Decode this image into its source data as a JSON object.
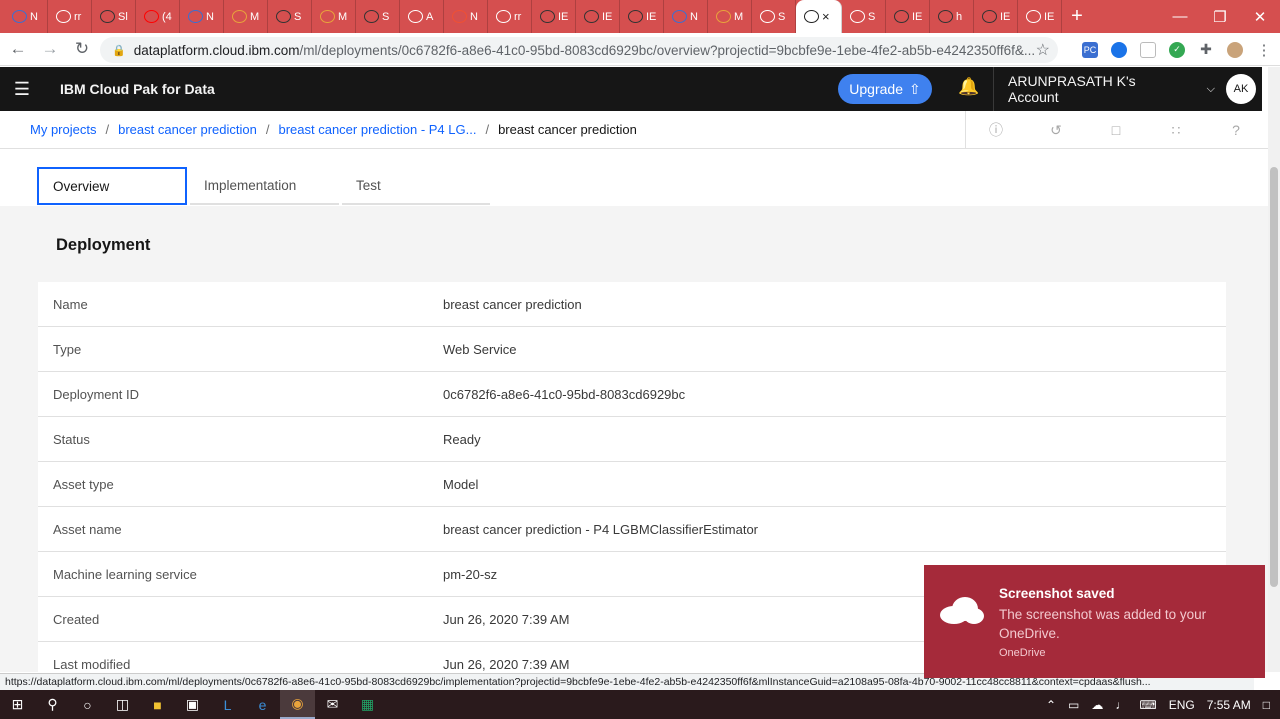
{
  "browser": {
    "tabs": [
      {
        "icon": "pc-icon",
        "title": "N",
        "color": "#3b6fd1"
      },
      {
        "icon": "notebook-icon",
        "title": "rr",
        "color": "#ffffff"
      },
      {
        "icon": "github-icon",
        "title": "Sl",
        "color": "#333333"
      },
      {
        "icon": "youtube-icon",
        "title": "(4",
        "color": "#ff0000"
      },
      {
        "icon": "pc-icon",
        "title": "N",
        "color": "#3b6fd1"
      },
      {
        "icon": "chrome-icon",
        "title": "M",
        "color": "#e8a33c"
      },
      {
        "icon": "github-icon",
        "title": "S",
        "color": "#333333"
      },
      {
        "icon": "chrome-icon",
        "title": "M",
        "color": "#e8a33c"
      },
      {
        "icon": "github-icon",
        "title": "S",
        "color": "#333333"
      },
      {
        "icon": "watson-icon",
        "title": "A",
        "color": "#ffffff"
      },
      {
        "icon": "git-icon",
        "title": "N",
        "color": "#f05033"
      },
      {
        "icon": "notebook-icon",
        "title": "rr",
        "color": "#ffffff"
      },
      {
        "icon": "github-icon",
        "title": "IE",
        "color": "#333333"
      },
      {
        "icon": "github-icon",
        "title": "IE",
        "color": "#333333"
      },
      {
        "icon": "github-icon",
        "title": "IE",
        "color": "#333333"
      },
      {
        "icon": "pc-icon",
        "title": "N",
        "color": "#3b6fd1"
      },
      {
        "icon": "chrome-icon",
        "title": "M",
        "color": "#e8a33c"
      },
      {
        "icon": "watson-icon",
        "title": "S",
        "color": "#ffffff"
      },
      {
        "icon": "watson-icon",
        "title": "×",
        "color": "#222222",
        "active": true
      },
      {
        "icon": "watson-icon",
        "title": "S",
        "color": "#ffffff"
      },
      {
        "icon": "github-icon",
        "title": "IE",
        "color": "#333333"
      },
      {
        "icon": "github-icon",
        "title": "h",
        "color": "#333333"
      },
      {
        "icon": "github-icon",
        "title": "IE",
        "color": "#333333"
      },
      {
        "icon": "watson-icon",
        "title": "IE",
        "color": "#ffffff"
      }
    ],
    "new_tab": "+",
    "url_host": "dataplatform.cloud.ibm.com",
    "url_path": "/ml/deployments/0c6782f6-a8e6-41c0-95bd-8083cd6929bc/overview?projectid=9bcbfe9e-1ebe-4fe2-ab5b-e4242350ff6f&...",
    "status_url": "https://dataplatform.cloud.ibm.com/ml/deployments/0c6782f6-a8e6-41c0-95bd-8083cd6929bc/implementation?projectid=9bcbfe9e-1ebe-4fe2-ab5b-e4242350ff6f&mlInstanceGuid=a2108a95-08fa-4b70-9002-11cc48cc8811&context=cpdaas&flush..."
  },
  "header": {
    "brand": "IBM Cloud Pak for Data",
    "upgrade_label": "Upgrade",
    "account_label": "ARUNPRASATH K's Account",
    "avatar_initials": "AK"
  },
  "breadcrumb": [
    {
      "label": "My projects",
      "link": true
    },
    {
      "label": "breast cancer prediction",
      "link": true
    },
    {
      "label": "breast cancer prediction - P4 LG...",
      "link": true
    },
    {
      "label": "breast cancer prediction",
      "link": false
    }
  ],
  "tabs": [
    {
      "label": "Overview",
      "selected": true
    },
    {
      "label": "Implementation",
      "selected": false
    },
    {
      "label": "Test",
      "selected": false
    }
  ],
  "section_title": "Deployment",
  "details": [
    {
      "key": "Name",
      "value": "breast cancer prediction"
    },
    {
      "key": "Type",
      "value": "Web Service"
    },
    {
      "key": "Deployment ID",
      "value": "0c6782f6-a8e6-41c0-95bd-8083cd6929bc"
    },
    {
      "key": "Status",
      "value": "Ready"
    },
    {
      "key": "Asset type",
      "value": "Model"
    },
    {
      "key": "Asset name",
      "value": "breast cancer prediction - P4 LGBMClassifierEstimator"
    },
    {
      "key": "Machine learning service",
      "value": "pm-20-sz"
    },
    {
      "key": "Created",
      "value": "Jun 26, 2020 7:39 AM"
    },
    {
      "key": "Last modified",
      "value": "Jun 26, 2020 7:39 AM"
    }
  ],
  "toast": {
    "title": "Screenshot saved",
    "message": "The screenshot was added to your OneDrive.",
    "source": "OneDrive"
  },
  "taskbar": {
    "language": "ENG",
    "time": "7:55 AM"
  },
  "colors": {
    "tabstrip": "#d54f4f",
    "ibm_header": "#161616",
    "link": "#0f62fe",
    "upgrade": "#3f81ef",
    "toast": "#a52a3a"
  }
}
